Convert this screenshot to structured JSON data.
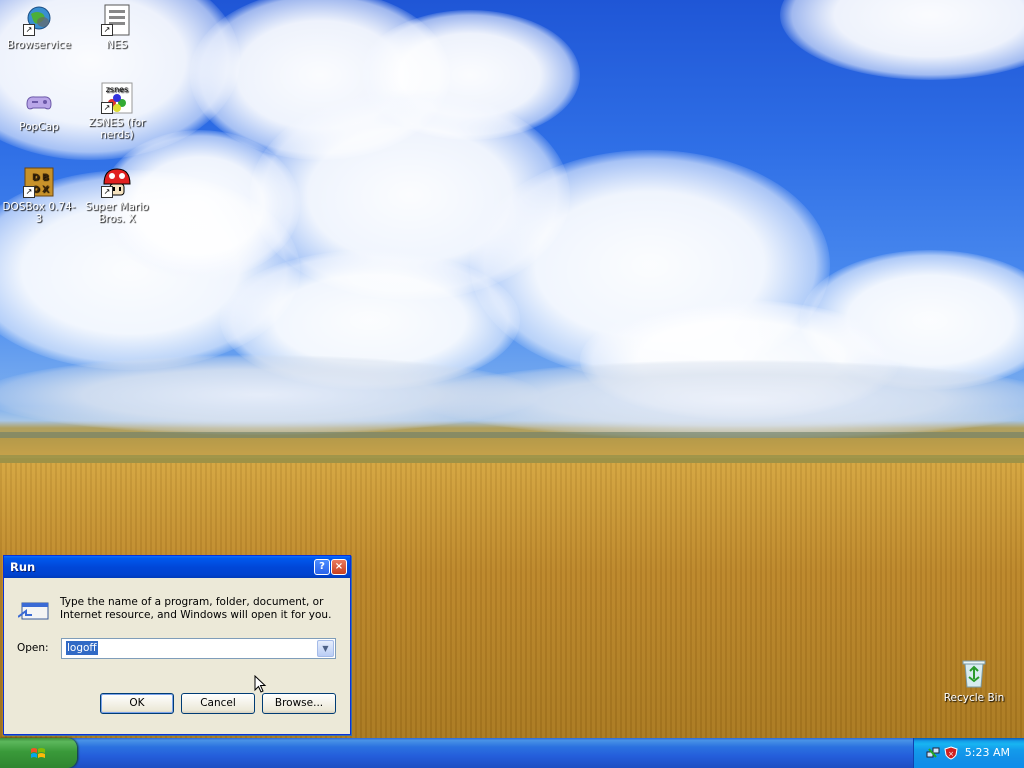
{
  "desktop_icons": [
    {
      "label": "Browservice",
      "icon": "browservice-globe-icon"
    },
    {
      "label": "NES",
      "icon": "nes-document-icon"
    },
    {
      "label": "PopCap",
      "icon": "popcap-gamepad-icon"
    },
    {
      "label": "ZSNES (for nerds)",
      "icon": "zsnes-icon"
    },
    {
      "label": "DOSBox 0.74-3",
      "icon": "dosbox-icon"
    },
    {
      "label": "Super Mario Bros. X",
      "icon": "mushroom-icon"
    }
  ],
  "recycle_bin": {
    "label": "Recycle Bin"
  },
  "run_dialog": {
    "title": "Run",
    "help_label": "?",
    "close_label": "×",
    "description": "Type the name of a program, folder, document, or Internet resource, and Windows will open it for you.",
    "open_label": "Open:",
    "open_value": "logoff",
    "ok_label": "OK",
    "cancel_label": "Cancel",
    "browse_label": "Browse..."
  },
  "taskbar": {
    "clock": "5:23 AM"
  },
  "colors": {
    "title_bar": "#0047d8",
    "dialog_bg": "#ece9d8",
    "taskbar": "#245edb",
    "start_button": "#3a9a3a",
    "tray": "#139beb"
  }
}
